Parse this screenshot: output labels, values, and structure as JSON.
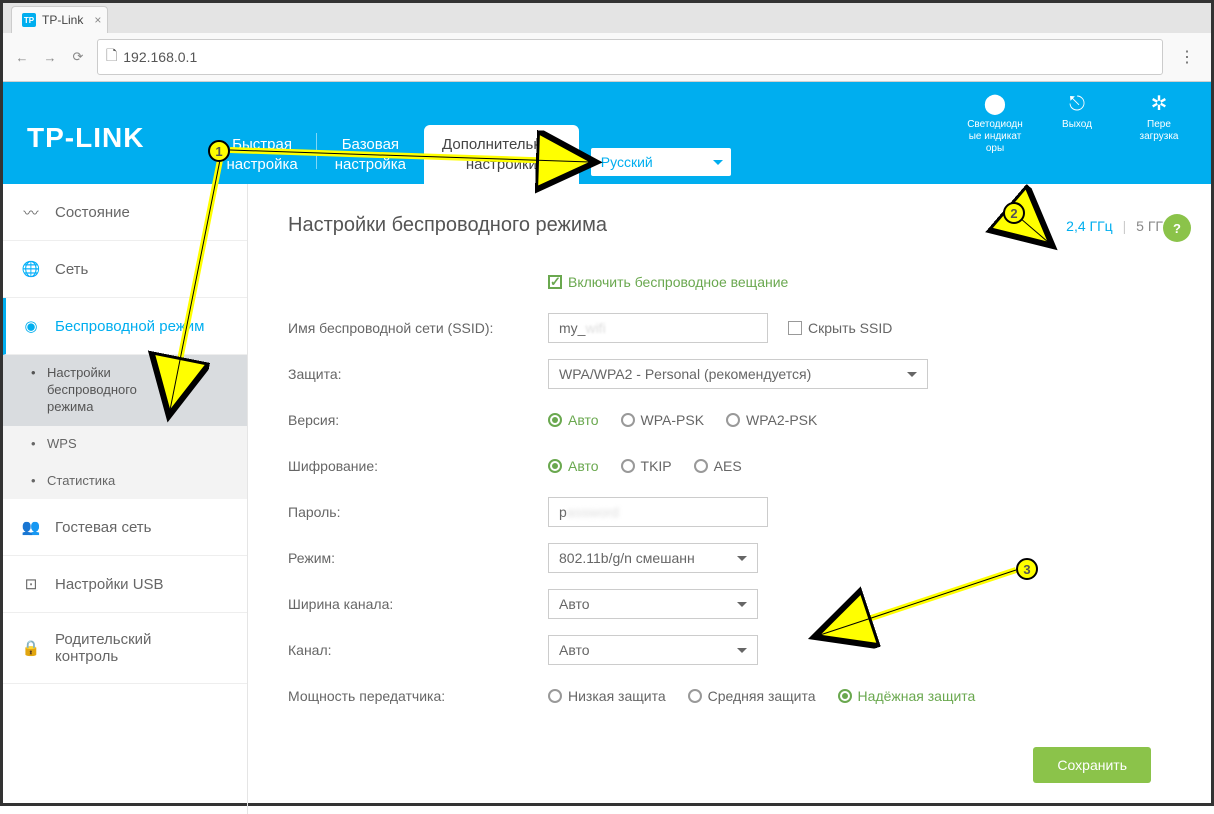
{
  "browser": {
    "tab_title": "TP-Link",
    "favicon_text": "TP",
    "url": "192.168.0.1"
  },
  "header": {
    "logo": "TP-LINK",
    "tabs": {
      "quick": "Быстрая\nнастройка",
      "basic": "Базовая\nнастройка",
      "advanced": "Дополнительные\nнастройки"
    },
    "language": "Русский",
    "icons": {
      "led": "Светодиодн\nые индикат\nоры",
      "logout": "Выход",
      "reboot": "Пере\nзагрузка"
    }
  },
  "sidebar": {
    "status": "Состояние",
    "network": "Сеть",
    "wireless": "Беспроводной режим",
    "sub_wireless_settings": "Настройки\nбеспроводного\nрежима",
    "sub_wps": "WPS",
    "sub_stats": "Статистика",
    "guest": "Гостевая сеть",
    "usb": "Настройки USB",
    "parental": "Родительский\nконтроль"
  },
  "page": {
    "title": "Настройки беспроводного режима",
    "freq_24": "2,4 ГГц",
    "freq_5": "5 ГГц",
    "help": "?"
  },
  "form": {
    "enable_radio": "Включить беспроводное вещание",
    "ssid_label": "Имя беспроводной сети (SSID):",
    "ssid_value": "my_",
    "hide_ssid": "Скрыть SSID",
    "security_label": "Защита:",
    "security_value": "WPA/WPA2 - Personal (рекомендуется)",
    "version_label": "Версия:",
    "version_auto": "Авто",
    "version_wpa": "WPA-PSK",
    "version_wpa2": "WPA2-PSK",
    "encryption_label": "Шифрование:",
    "encryption_auto": "Авто",
    "encryption_tkip": "TKIP",
    "encryption_aes": "AES",
    "password_label": "Пароль:",
    "password_value": "p",
    "mode_label": "Режим:",
    "mode_value": "802.11b/g/n смешанн",
    "width_label": "Ширина канала:",
    "width_value": "Авто",
    "channel_label": "Канал:",
    "channel_value": "Авто",
    "txpower_label": "Мощность передатчика:",
    "txpower_low": "Низкая защита",
    "txpower_mid": "Средняя защита",
    "txpower_high": "Надёжная защита",
    "save": "Сохранить"
  },
  "callouts": {
    "c1": "1",
    "c2": "2",
    "c3": "3"
  }
}
